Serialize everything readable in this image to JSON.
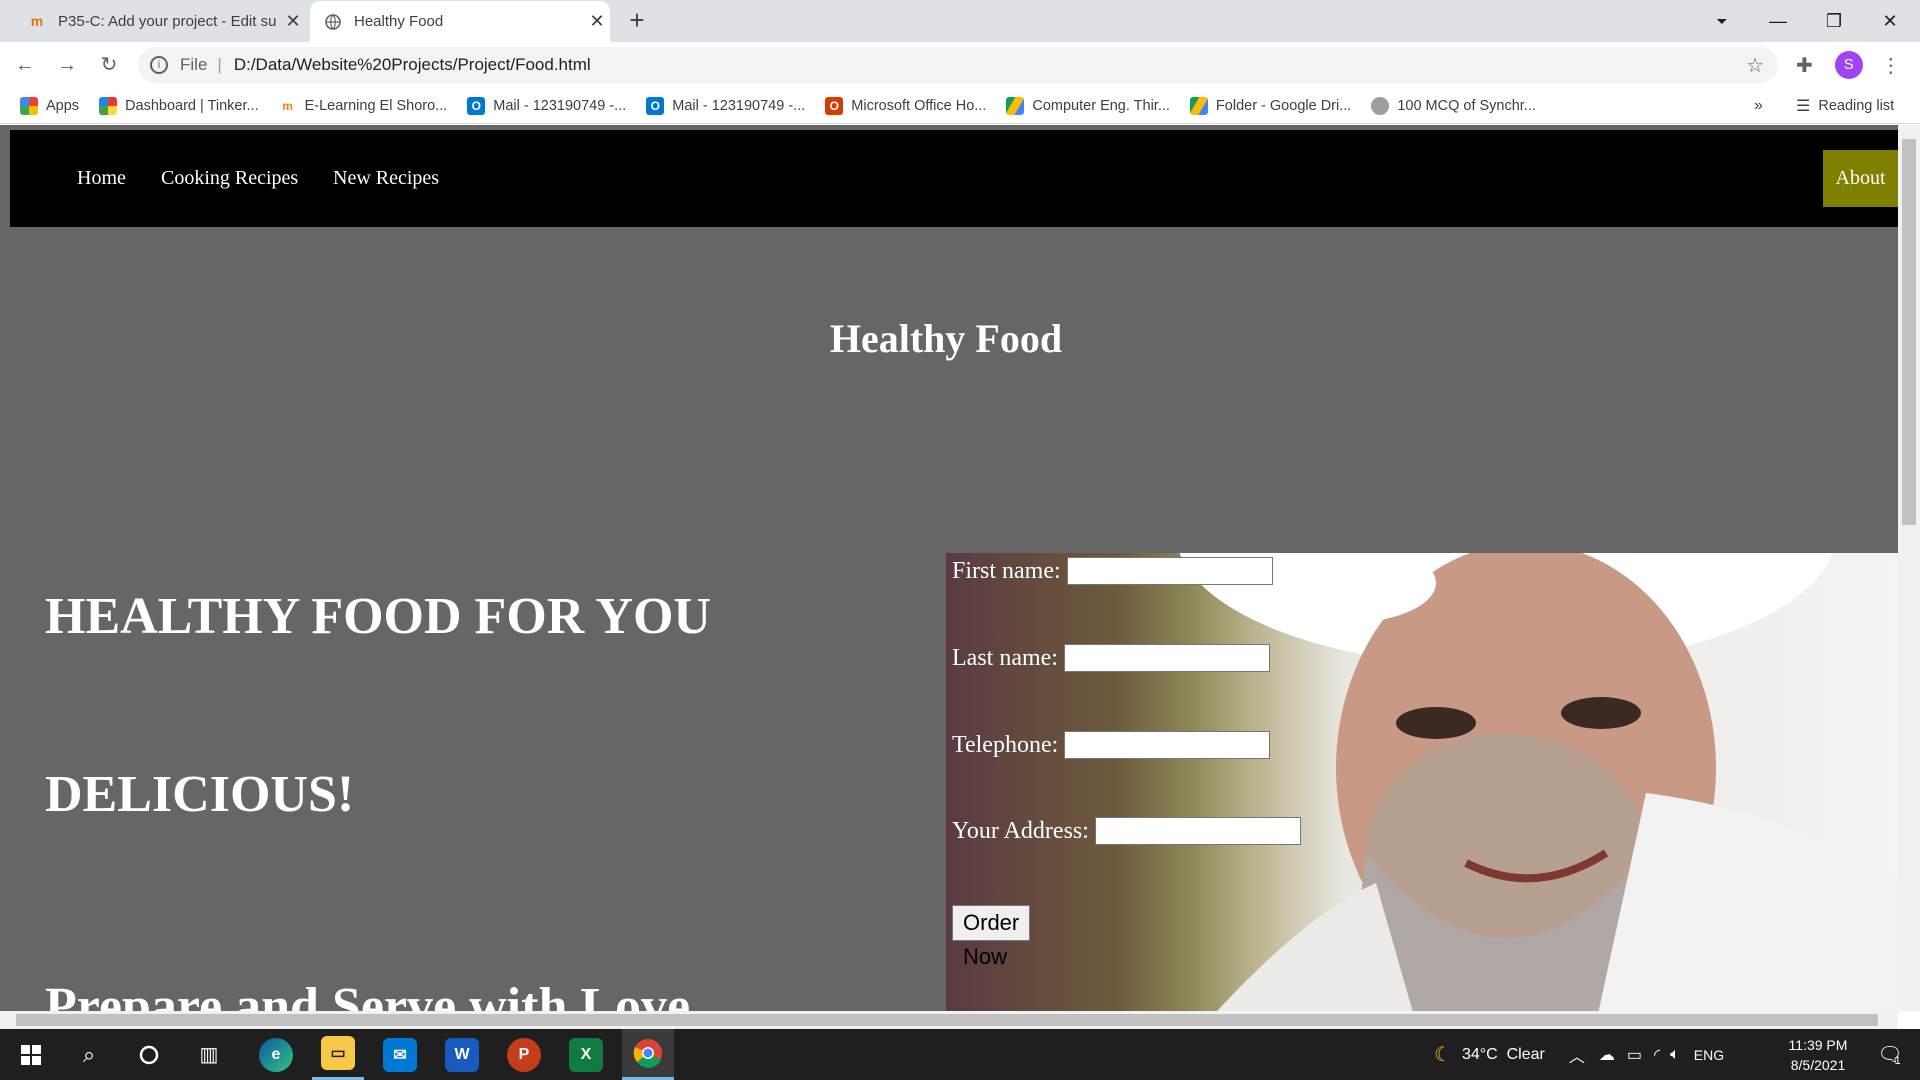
{
  "browser": {
    "tabs": [
      {
        "title": "P35-C: Add your project - Edit su",
        "icon": "tinkercad-icon",
        "active": false
      },
      {
        "title": "Healthy Food",
        "icon": "globe-icon",
        "active": true
      }
    ],
    "address": {
      "scheme": "File",
      "url": "D:/Data/Website%20Projects/Project/Food.html"
    },
    "profile_initial": "S",
    "bookmarks": [
      {
        "label": "Apps",
        "icon": "apps-grid-icon",
        "color": "#4285f4"
      },
      {
        "label": "Dashboard | Tinker...",
        "icon": "tinkercad-icon",
        "color": "#e8710a"
      },
      {
        "label": "E-Learning El Shoro...",
        "icon": "moodle-icon",
        "color": "#f98012"
      },
      {
        "label": "Mail - 123190749 -...",
        "icon": "outlook-icon",
        "color": "#0078d4"
      },
      {
        "label": "Mail - 123190749 -...",
        "icon": "outlook-icon",
        "color": "#0078d4"
      },
      {
        "label": "Microsoft Office Ho...",
        "icon": "office-icon",
        "color": "#d83b01"
      },
      {
        "label": "Computer Eng. Thir...",
        "icon": "google-drive-icon",
        "color": "#0f9d58"
      },
      {
        "label": "Folder - Google Dri...",
        "icon": "google-drive-icon",
        "color": "#0f9d58"
      },
      {
        "label": "100 MCQ of Synchr...",
        "icon": "site-icon",
        "color": "#9e9e9e"
      }
    ],
    "overflow_label": "»",
    "reading_list_label": "Reading list"
  },
  "site": {
    "nav": [
      "Home",
      "Cooking Recipes",
      "New Recipes"
    ],
    "about_label": "About",
    "hero_title": "Healthy Food",
    "headline_1": "HEALTHY FOOD FOR YOU",
    "headline_2": "DELICIOUS!",
    "headline_3": "Prepare and Serve with Love",
    "form": {
      "first_name_label": "First name:",
      "last_name_label": "Last name:",
      "telephone_label": "Telephone:",
      "address_label": "Your Address:",
      "submit_label": "Order Now"
    },
    "colors": {
      "nav_bg": "#000000",
      "page_bg": "#666666",
      "about_bg": "#808000"
    }
  },
  "taskbar": {
    "apps": [
      "windows-start-icon",
      "search-icon",
      "cortana-icon",
      "task-view-icon",
      "edge-icon",
      "file-explorer-icon",
      "mail-icon",
      "word-icon",
      "powerpoint-icon",
      "excel-icon",
      "chrome-icon"
    ],
    "weather": "34°C  Clear",
    "language": "ENG",
    "time": "11:39 PM",
    "date": "8/5/2021",
    "notification_count": "1"
  }
}
